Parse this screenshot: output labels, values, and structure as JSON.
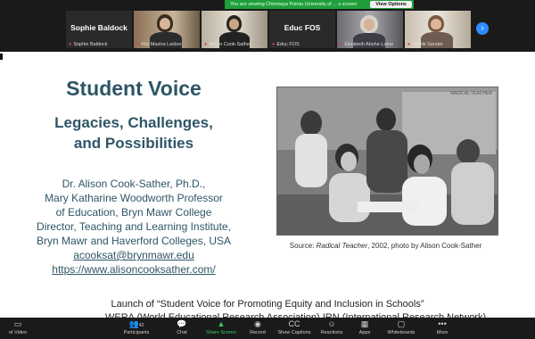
{
  "banner": {
    "text": "You are viewing Chinmaya Pointu University of ... s screen",
    "view_options": "View Options"
  },
  "participants": [
    {
      "name": "Sophie Baldock",
      "caption": "Sophie Baldock",
      "mode": "name"
    },
    {
      "name": "",
      "caption": "Kiki Mastra Leiden",
      "mode": "video"
    },
    {
      "name": "",
      "caption": "Alison Cook-Sather",
      "mode": "video"
    },
    {
      "name": "Educ FOS",
      "caption": "Educ FOS",
      "mode": "name"
    },
    {
      "name": "",
      "caption": "Elizabeth Abshe-Lutoe",
      "mode": "video"
    },
    {
      "name": "",
      "caption": "Zettrik Sander",
      "mode": "video"
    }
  ],
  "slide": {
    "title": "Student Voice",
    "subtitle1": "Legacies, Challenges,",
    "subtitle2": "and Possibilities",
    "author_lines": [
      "Dr. Alison Cook-Sather, Ph.D.,",
      "Mary Katharine Woodworth Professor",
      "of Education, Bryn Mawr College",
      "Director, Teaching and Learning Institute,",
      "Bryn Mawr and Haverford Colleges, USA"
    ],
    "email": "acooksat@brynmawr.edu",
    "website": "https://www.alisoncooksather.com/",
    "photo_note": "RADICAL TEACHER",
    "source_prefix": "Source: ",
    "source_italic": "Radical Teacher",
    "source_suffix": ", 2002, photo by Alison Cook-Sather",
    "launch": "Launch of “Student Voice for Promoting Equity and Inclusion in Schools”",
    "launch2": "WERA (World Educational Research Association) IRN (International Research Network)"
  },
  "toolbar": {
    "items": [
      {
        "label": "ot Video",
        "icon": "video-icon"
      },
      {
        "label": "Participants",
        "icon": "participants-icon",
        "count": "42"
      },
      {
        "label": "Chat",
        "icon": "chat-icon"
      },
      {
        "label": "Share Screen",
        "icon": "share-screen-icon"
      },
      {
        "label": "Record",
        "icon": "record-icon"
      },
      {
        "label": "Show Captions",
        "icon": "captions-icon"
      },
      {
        "label": "Reactions",
        "icon": "reactions-icon"
      },
      {
        "label": "Apps",
        "icon": "apps-icon"
      },
      {
        "label": "Whiteboards",
        "icon": "whiteboards-icon"
      },
      {
        "label": "More",
        "icon": "more-icon"
      }
    ]
  },
  "colors": {
    "accent": "#2d8cff",
    "share": "#2fcf5f",
    "title": "#2e5566",
    "banner": "#1f9e3c"
  }
}
